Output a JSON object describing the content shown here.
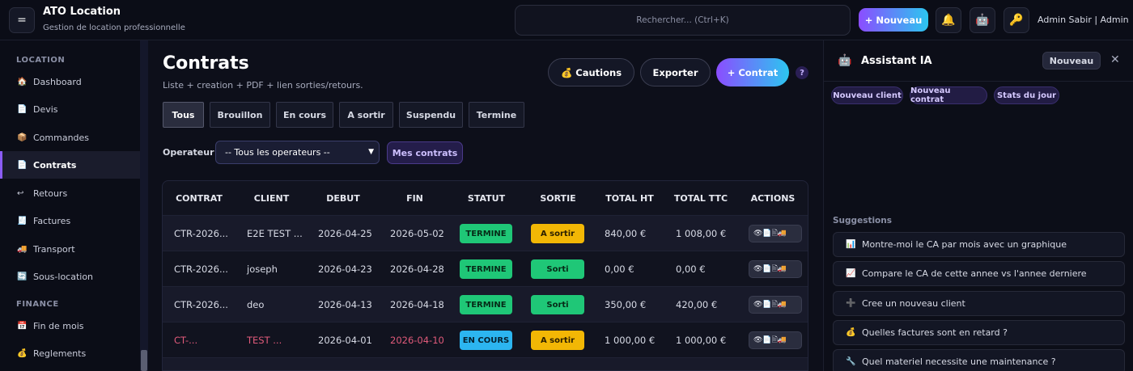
{
  "app": {
    "title": "ATO Location",
    "subtitle": "Gestion de location professionnelle",
    "menu_icon": "="
  },
  "topbar": {
    "search_placeholder": "Rechercher... (Ctrl+K)",
    "new_label": "+ Nouveau",
    "user": "Admin Sabir | Admin",
    "icons": {
      "bell": "🔔",
      "robot": "🤖",
      "key": "🔑"
    }
  },
  "sidebar": {
    "sections": [
      {
        "label": "LOCATION"
      },
      {
        "label": "FINANCE"
      }
    ],
    "items": [
      {
        "icon": "🏠",
        "label": "Dashboard"
      },
      {
        "icon": "📄",
        "label": "Devis"
      },
      {
        "icon": "📦",
        "label": "Commandes"
      },
      {
        "icon": "📄",
        "label": "Contrats"
      },
      {
        "icon": "↩",
        "label": "Retours"
      },
      {
        "icon": "🧾",
        "label": "Factures"
      },
      {
        "icon": "🚚",
        "label": "Transport"
      },
      {
        "icon": "🔄",
        "label": "Sous-location"
      },
      {
        "icon": "📅",
        "label": "Fin de mois"
      },
      {
        "icon": "💰",
        "label": "Reglements"
      }
    ]
  },
  "main": {
    "title": "Contrats",
    "subtitle": "Liste + creation + PDF + lien sorties/retours.",
    "buttons": {
      "cautions": "💰 Cautions",
      "export": "Exporter",
      "contract": "+ Contrat",
      "help": "?"
    },
    "filters": [
      "Tous",
      "Brouillon",
      "En cours",
      "A sortir",
      "Suspendu",
      "Termine"
    ],
    "operator_label": "Operateur :",
    "operator_value": "-- Tous les operateurs --",
    "my_contracts": "Mes contrats",
    "table": {
      "headers": [
        "CONTRAT",
        "CLIENT",
        "DEBUT",
        "FIN",
        "STATUT",
        "SORTIE",
        "TOTAL HT",
        "TOTAL TTC",
        "ACTIONS"
      ],
      "rows": [
        {
          "contract": "CTR-2026...",
          "client": "E2E TEST ...",
          "start": "2026-04-25",
          "end": "2026-05-02",
          "status": "TERMINE",
          "exit": "A sortir",
          "ht": "840,00 €",
          "ttc": "1 008,00 €"
        },
        {
          "contract": "CTR-2026...",
          "client": "joseph",
          "start": "2026-04-23",
          "end": "2026-04-28",
          "status": "TERMINE",
          "exit": "Sorti",
          "ht": "0,00 €",
          "ttc": "0,00 €"
        },
        {
          "contract": "CTR-2026...",
          "client": "deo",
          "start": "2026-04-13",
          "end": "2026-04-18",
          "status": "TERMINE",
          "exit": "Sorti",
          "ht": "350,00 €",
          "ttc": "420,00 €"
        },
        {
          "contract": "CT-...",
          "client": "TEST ...",
          "start": "2026-04-01",
          "end": "2026-04-10",
          "status": "EN COURS",
          "exit": "A sortir",
          "ht": "1 000,00 €",
          "ttc": "1 000,00 €"
        }
      ],
      "action_icons": "👁📄🖹🚚"
    }
  },
  "assistant": {
    "title": "Assistant IA",
    "new_label": "Nouveau",
    "close": "✕",
    "chips": [
      "Nouveau client",
      "Nouveau contrat",
      "Stats du jour"
    ],
    "suggestions_label": "Suggestions",
    "suggestions": [
      {
        "icon": "📊",
        "label": "Montre-moi le CA par mois avec un graphique"
      },
      {
        "icon": "📈",
        "label": "Compare le CA de cette annee vs l'annee derniere"
      },
      {
        "icon": "➕",
        "label": "Cree un nouveau client"
      },
      {
        "icon": "💰",
        "label": "Quelles factures sont en retard ?"
      },
      {
        "icon": "🔧",
        "label": "Quel materiel necessite une maintenance ?"
      }
    ]
  },
  "colors": {
    "accent_start": "#8b4dff",
    "accent_end": "#2cc6f0",
    "termine": "#1fc777",
    "a_sortir": "#f2b705",
    "en_cours": "#2cb5f0",
    "overdue_text": "#e05a7a"
  }
}
